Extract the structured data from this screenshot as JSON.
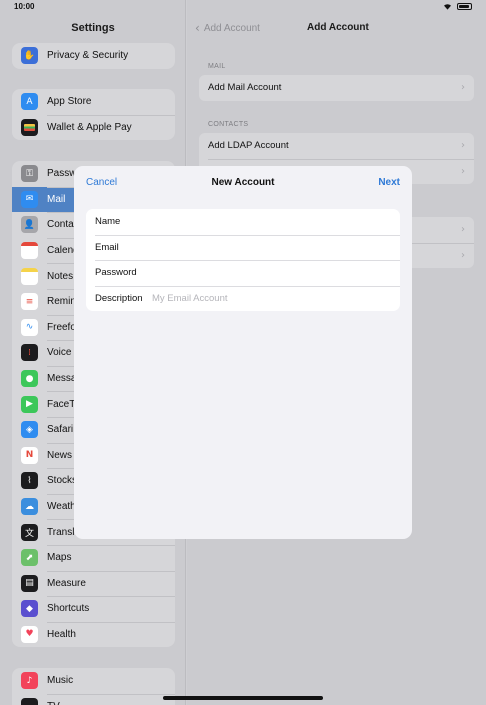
{
  "status_bar": {
    "time": "10:00"
  },
  "sidebar": {
    "title": "Settings",
    "groups": [
      {
        "items": [
          {
            "label": "Privacy & Security",
            "icon": "hand-icon",
            "color": "#3c6fd8"
          }
        ]
      },
      {
        "items": [
          {
            "label": "App Store",
            "icon": "appstore-icon",
            "color": "#2f8cf0"
          },
          {
            "label": "Wallet & Apple Pay",
            "icon": "wallet-icon",
            "color": "#1c1c1e"
          }
        ]
      },
      {
        "items": [
          {
            "label": "Passw",
            "icon": "key-icon",
            "color": "#8a8a8e"
          },
          {
            "label": "Mail",
            "icon": "mail-icon",
            "color": "#2f8cf0",
            "selected": true
          },
          {
            "label": "Conta",
            "icon": "contacts-icon",
            "color": "#a6a6aa"
          },
          {
            "label": "Calend",
            "icon": "calendar-icon",
            "color": "#ffffff"
          },
          {
            "label": "Notes",
            "icon": "notes-icon",
            "color": "#f5d34a"
          },
          {
            "label": "Remin",
            "icon": "reminders-icon",
            "color": "#ffffff"
          },
          {
            "label": "Freefo",
            "icon": "freeform-icon",
            "color": "#ffffff"
          },
          {
            "label": "Voice",
            "icon": "voice-memos-icon",
            "color": "#1c1c1e"
          },
          {
            "label": "Messa",
            "icon": "messages-icon",
            "color": "#3cc75a"
          },
          {
            "label": "FaceTi",
            "icon": "facetime-icon",
            "color": "#3cc75a"
          },
          {
            "label": "Safari",
            "icon": "safari-icon",
            "color": "#2f8cf0"
          },
          {
            "label": "News",
            "icon": "news-icon",
            "color": "#ffffff"
          },
          {
            "label": "Stocks",
            "icon": "stocks-icon",
            "color": "#1c1c1e"
          },
          {
            "label": "Weath",
            "icon": "weather-icon",
            "color": "#3b8ede"
          },
          {
            "label": "Transl",
            "icon": "translate-icon",
            "color": "#1c1c1e"
          },
          {
            "label": "Maps",
            "icon": "maps-icon",
            "color": "#6cc06a"
          },
          {
            "label": "Measure",
            "icon": "measure-icon",
            "color": "#1c1c1e"
          },
          {
            "label": "Shortcuts",
            "icon": "shortcuts-icon",
            "color": "#5a4fcf"
          },
          {
            "label": "Health",
            "icon": "health-icon",
            "color": "#ffffff"
          }
        ]
      },
      {
        "items": [
          {
            "label": "Music",
            "icon": "music-icon",
            "color": "#f2435a"
          },
          {
            "label": "TV",
            "icon": "tv-icon",
            "color": "#1c1c1e"
          }
        ]
      }
    ]
  },
  "detail": {
    "back_label": "Add Account",
    "title": "Add Account",
    "mail_header": "MAIL",
    "mail_rows": [
      "Add Mail Account"
    ],
    "contacts_header": "CONTACTS",
    "contacts_rows": [
      "Add LDAP Account",
      ""
    ],
    "calendar_rows": [
      "",
      ""
    ]
  },
  "sheet": {
    "cancel_label": "Cancel",
    "title": "New Account",
    "next_label": "Next",
    "fields": [
      {
        "label": "Name",
        "value": "",
        "placeholder": ""
      },
      {
        "label": "Email",
        "value": "",
        "placeholder": ""
      },
      {
        "label": "Password",
        "value": "",
        "placeholder": ""
      },
      {
        "label": "Description",
        "value": "",
        "placeholder": "My Email Account"
      }
    ]
  },
  "colors": {
    "accent": "#2f7ad6",
    "selected_row": "#4f82c4"
  }
}
